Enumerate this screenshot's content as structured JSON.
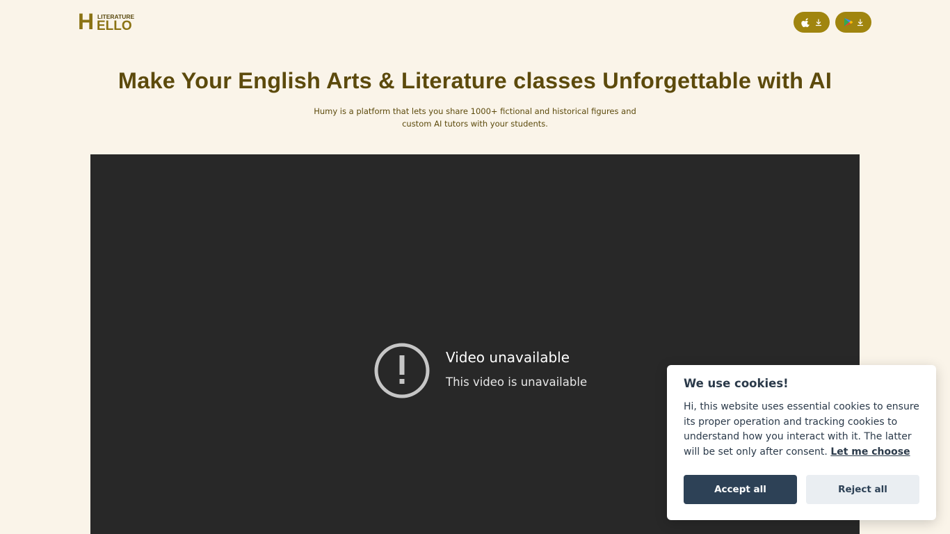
{
  "header": {
    "logo": {
      "small_text": "LITERATURE",
      "big_initial": "H",
      "big_rest": "ELLO"
    },
    "store_buttons": [
      {
        "name": "app-store",
        "icon": "apple-icon",
        "action_icon": "download-icon"
      },
      {
        "name": "google-play",
        "icon": "google-play-icon",
        "action_icon": "download-icon"
      }
    ]
  },
  "hero": {
    "title": "Make Your English Arts & Literature classes Unforgettable with AI",
    "subtitle": "Humy is a platform that lets you share 1000+ fictional and historical figures and custom AI tutors with your students."
  },
  "video": {
    "error_title": "Video unavailable",
    "error_message": "This video is unavailable",
    "icon": "alert-circle-icon"
  },
  "cookie_banner": {
    "title": "We use cookies!",
    "text": "Hi, this website uses essential cookies to ensure its proper operation and tracking cookies to understand how you interact with it. The latter will be set only after consent.",
    "link_label": "Let me choose",
    "accept_label": "Accept all",
    "reject_label": "Reject all"
  },
  "colors": {
    "background": "#faf4e9",
    "brand": "#a0850f",
    "heading": "#5c4a0c",
    "video_bg": "#282828",
    "cookie_primary": "#2d4156",
    "cookie_secondary": "#eaeef2"
  }
}
